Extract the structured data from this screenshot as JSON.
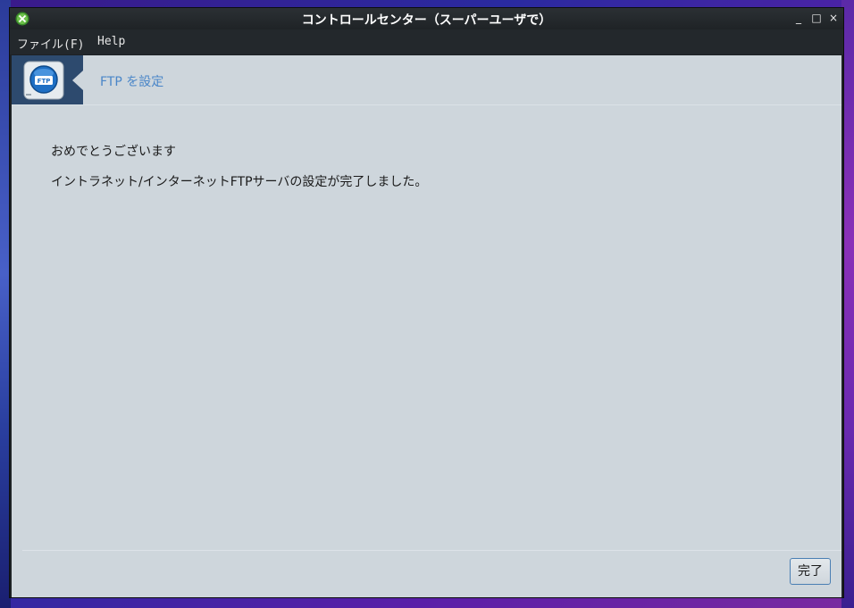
{
  "window": {
    "title": "コントロールセンター（スーパーユーザで）",
    "minimize": "_",
    "maximize": "□",
    "close": "×"
  },
  "menu": {
    "file": "ファイル(F)",
    "help": "Help"
  },
  "banner": {
    "title": "FTP を設定",
    "icon": "ftp-icon",
    "icon_text": "FTP"
  },
  "main": {
    "heading": "おめでとうございます",
    "message": "イントラネット/インターネットFTPサーバの設定が完了しました。"
  },
  "footer": {
    "finish_label": "完了"
  },
  "colors": {
    "content_bg": "#ced6dc",
    "banner_title": "#4a86c8",
    "button_border": "#4a7fb3"
  }
}
